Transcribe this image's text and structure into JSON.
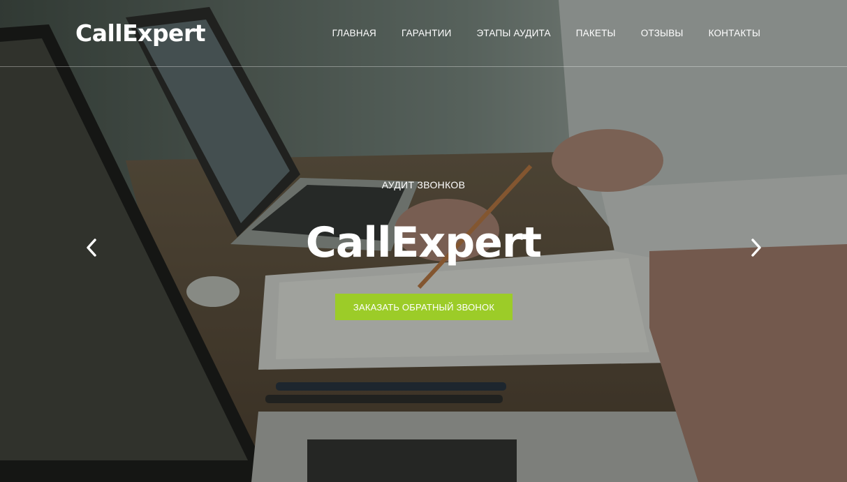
{
  "header": {
    "logo": "CallExpert",
    "nav": [
      "ГЛАВНАЯ",
      "ГАРАНТИИ",
      "ЭТАПЫ АУДИТА",
      "ПАКЕТЫ",
      "ОТЗЫВЫ",
      "КОНТАКТЫ"
    ]
  },
  "hero": {
    "kicker": "АУДИТ ЗВОНКОВ",
    "title": "CallExpert",
    "cta_label": "ЗАКАЗАТЬ ОБРАТНЫЙ ЗВОНОК",
    "prev_icon": "chevron-left-icon",
    "next_icon": "chevron-right-icon",
    "background": "office desk photo with laptops, documents, pens and hands"
  },
  "colors": {
    "accent": "#9ccc28",
    "text": "#ffffff"
  }
}
